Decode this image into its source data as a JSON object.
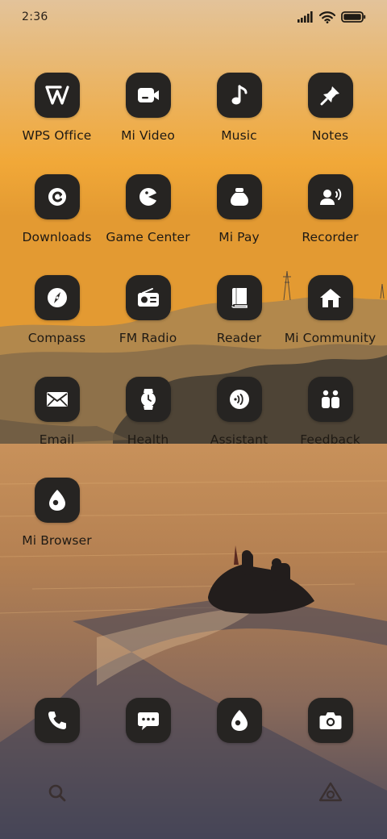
{
  "status_bar": {
    "time": "2:36",
    "icons": [
      "signal-icon",
      "wifi-icon",
      "battery-icon"
    ]
  },
  "apps": [
    {
      "label": "WPS Office",
      "icon": "wps-office-icon"
    },
    {
      "label": "Mi Video",
      "icon": "mi-video-icon"
    },
    {
      "label": "Music",
      "icon": "music-note-icon"
    },
    {
      "label": "Notes",
      "icon": "pin-icon"
    },
    {
      "label": "Downloads",
      "icon": "downloads-icon"
    },
    {
      "label": "Game Center",
      "icon": "game-center-icon"
    },
    {
      "label": "Mi Pay",
      "icon": "mi-pay-icon"
    },
    {
      "label": "Recorder",
      "icon": "recorder-icon"
    },
    {
      "label": "Compass",
      "icon": "compass-icon"
    },
    {
      "label": "FM Radio",
      "icon": "radio-icon"
    },
    {
      "label": "Reader",
      "icon": "book-icon"
    },
    {
      "label": "Mi Community",
      "icon": "home-icon"
    },
    {
      "label": "Email",
      "icon": "envelope-icon"
    },
    {
      "label": "Health",
      "icon": "watch-icon"
    },
    {
      "label": "Assistant",
      "icon": "assistant-icon"
    },
    {
      "label": "Feedback",
      "icon": "feedback-icon"
    },
    {
      "label": "Mi Browser",
      "icon": "browser-icon"
    }
  ],
  "dock": [
    {
      "icon": "phone-icon"
    },
    {
      "icon": "message-icon"
    },
    {
      "icon": "browser-icon"
    },
    {
      "icon": "camera-icon"
    }
  ],
  "bottom_bar": {
    "left_icon": "search-icon",
    "right_icon": "assistant-triangle-icon"
  },
  "colors": {
    "icon_background": "#262422",
    "icon_glyph": "#ffffff",
    "label_text": "#1f1a14"
  }
}
